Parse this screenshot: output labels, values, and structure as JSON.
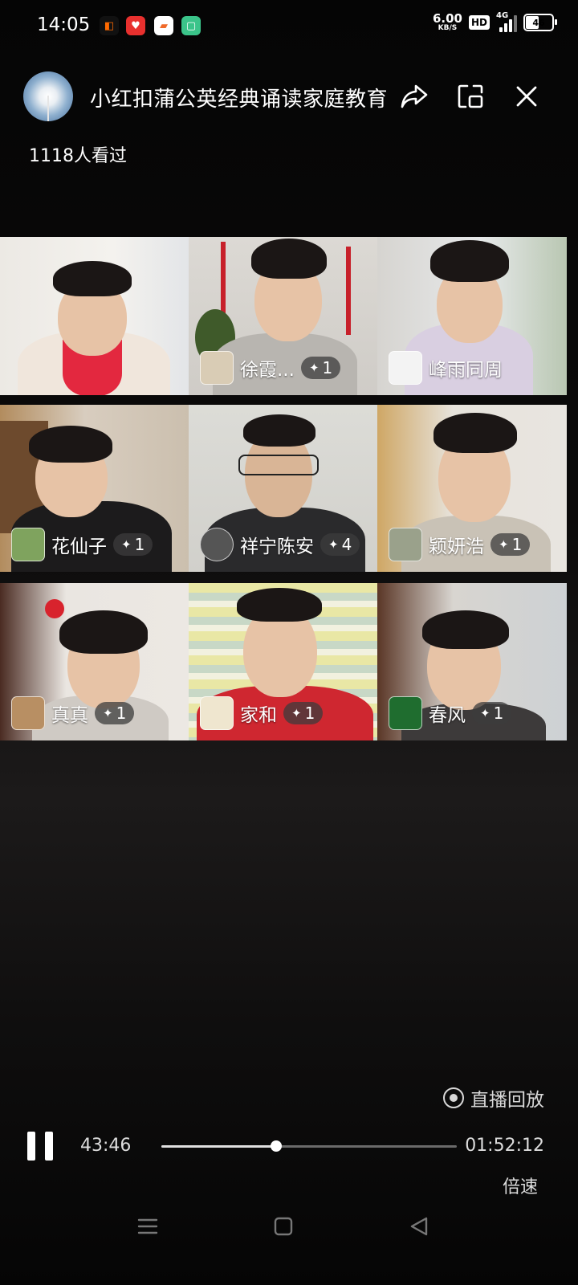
{
  "status_bar": {
    "time": "14:05",
    "net_speed": "6.00",
    "net_unit": "KB/S",
    "hd_badge": "HD",
    "network": "4G",
    "battery_level": "46",
    "app_icons": [
      "office-app-icon",
      "health-app-icon",
      "game-app-icon",
      "chat-app-icon"
    ]
  },
  "header": {
    "title": "小红扣蒲公英经典诵读家庭教育",
    "view_count": "1118人看过",
    "avatar_icon": "dandelion-avatar-icon",
    "share_icon": "share-icon",
    "pip_icon": "picture-in-picture-icon",
    "close_icon": "close-icon"
  },
  "participants": [
    {
      "name": "",
      "likes": ""
    },
    {
      "name": "徐霞...",
      "likes": "1"
    },
    {
      "name": "峰雨同周",
      "likes": ""
    },
    {
      "name": "花仙子",
      "likes": "1"
    },
    {
      "name": "祥宁陈安",
      "likes": "4"
    },
    {
      "name": "颖妍浩",
      "likes": "1"
    },
    {
      "name": "真真",
      "likes": "1"
    },
    {
      "name": "家和",
      "likes": "1"
    },
    {
      "name": "春风",
      "likes": "1"
    }
  ],
  "player": {
    "replay_label": "直播回放",
    "current_time": "43:46",
    "total_time": "01:52:12",
    "progress": 0.388,
    "speed_label": "倍速",
    "pause_icon": "pause-icon"
  },
  "nav_bar": {
    "menu_icon": "menu-icon",
    "home_icon": "home-icon",
    "back_icon": "back-icon"
  }
}
